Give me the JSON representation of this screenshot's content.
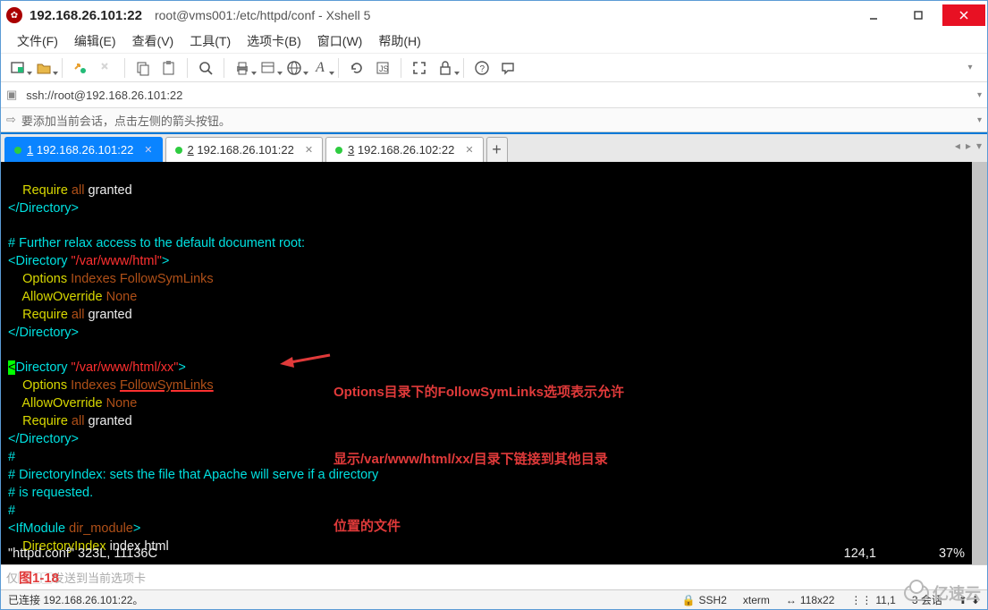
{
  "title": {
    "ip": "192.168.26.101:22",
    "path": "root@vms001:/etc/httpd/conf - Xshell 5"
  },
  "menu": [
    "文件(F)",
    "编辑(E)",
    "查看(V)",
    "工具(T)",
    "选项卡(B)",
    "窗口(W)",
    "帮助(H)"
  ],
  "address": {
    "url": "ssh://root@192.168.26.101:22"
  },
  "hint": "要添加当前会话，点击左侧的箭头按钮。",
  "tabs": [
    {
      "n": "1",
      "label": "192.168.26.101:22",
      "active": true
    },
    {
      "n": "2",
      "label": "192.168.26.101:22",
      "active": false
    },
    {
      "n": "3",
      "label": "192.168.26.102:22",
      "active": false
    }
  ],
  "term": {
    "l1a": "    Require",
    "l1b": " all",
    "l1c": " granted",
    "l2": "</Directory>",
    "l4": "# Further relax access to the default document root:",
    "l5a": "<Directory ",
    "l5b": "\"/var/www/html\"",
    "l5c": ">",
    "l6a": "    Options",
    "l6b": " Indexes FollowSymLinks",
    "l7a": "    AllowOverride",
    "l7b": " None",
    "l8a": "    Require",
    "l8b": " all",
    "l8c": " granted",
    "l9": "</Directory>",
    "l11lt": "<",
    "l11a": "Directory ",
    "l11b": "\"/var/www/html/xx\"",
    "l11c": ">",
    "l12a": "    Options",
    "l12b": " Indexes ",
    "l12c": "FollowSymLinks",
    "l13a": "    AllowOverride",
    "l13b": " None",
    "l14a": "    Require",
    "l14b": " all",
    "l14c": " granted",
    "l15": "</Directory>",
    "l16": "#",
    "l17": "# DirectoryIndex: sets the file that Apache will serve if a directory",
    "l18": "# is requested.",
    "l19": "#",
    "l20a": "<IfModule ",
    "l20b": "dir_module",
    "l20c": ">",
    "l21a": "    DirectoryIndex",
    "l21b": " index.html",
    "vimfile": "\"httpd.conf\" 323L, 11136C",
    "vimpos": "124,1",
    "vimpct": "37%"
  },
  "annotation": {
    "line1": "Options目录下的FollowSymLinks选项表示允许",
    "line2": "显示/var/www/html/xx/目录下链接到其他目录",
    "line3": "位置的文件"
  },
  "figure": "图1-18",
  "inputhint": "仅▢▢▢发送到当前选项卡",
  "status": {
    "left": "已连接 192.168.26.101:22。",
    "ssh": "SSH2",
    "term": "xterm",
    "size": "118x22",
    "cursor": "11,1",
    "sess": "3 会话"
  },
  "watermark": "亿速云"
}
